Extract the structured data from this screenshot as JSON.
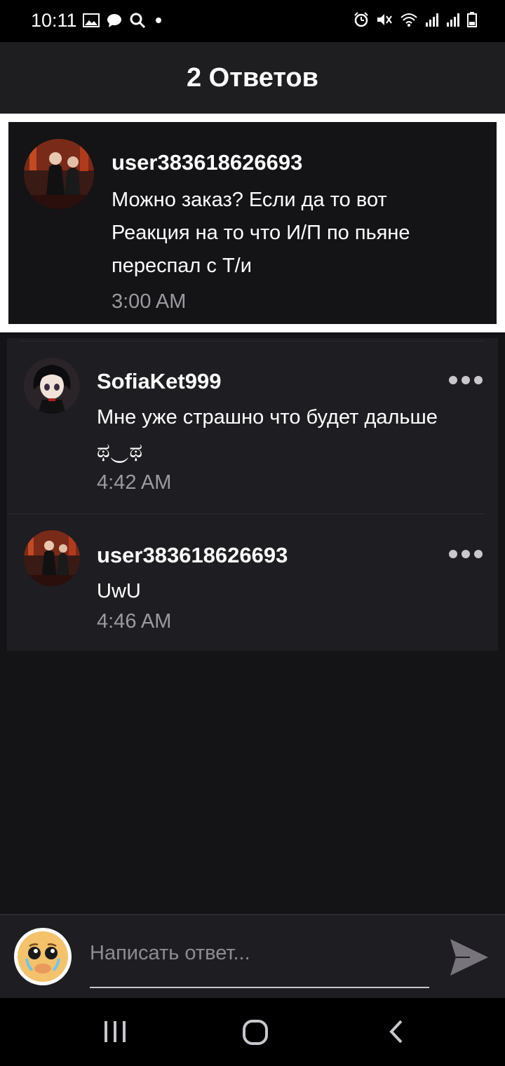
{
  "status_bar": {
    "time": "10:11"
  },
  "header": {
    "title": "2 Ответов"
  },
  "parent_comment": {
    "username": "user383618626693",
    "text_lines": [
      "Можно заказ? Если да то вот",
      "Реакция на то что И/П по пьяне",
      "переспал с Т/и"
    ],
    "time": "3:00 AM"
  },
  "replies": [
    {
      "username": "SofiaKet999",
      "text_lines": [
        "Мне уже страшно что будет дальше",
        "ಥ‿ಥ"
      ],
      "time": "4:42 AM"
    },
    {
      "username": "user383618626693",
      "text_lines": [
        "UwU"
      ],
      "time": "4:46 AM"
    }
  ],
  "composer": {
    "placeholder": "Написать ответ..."
  },
  "colors": {
    "background": "#141316",
    "header": "#1e1d20",
    "secondary_text": "#9c9aa0",
    "highlight_border": "#ffffff"
  },
  "icons": {
    "status_left": [
      "image-icon",
      "chat-bubble-icon",
      "search-icon",
      "dot-icon"
    ],
    "status_right": [
      "alarm-icon",
      "mute-icon",
      "wifi-icon",
      "signal-icon",
      "signal-icon",
      "battery-icon"
    ],
    "composer_avatar": "crying-emoji-icon",
    "send": "send-icon",
    "more": "more-dots-icon",
    "nav": [
      "recent-apps-icon",
      "home-icon",
      "back-icon"
    ]
  }
}
